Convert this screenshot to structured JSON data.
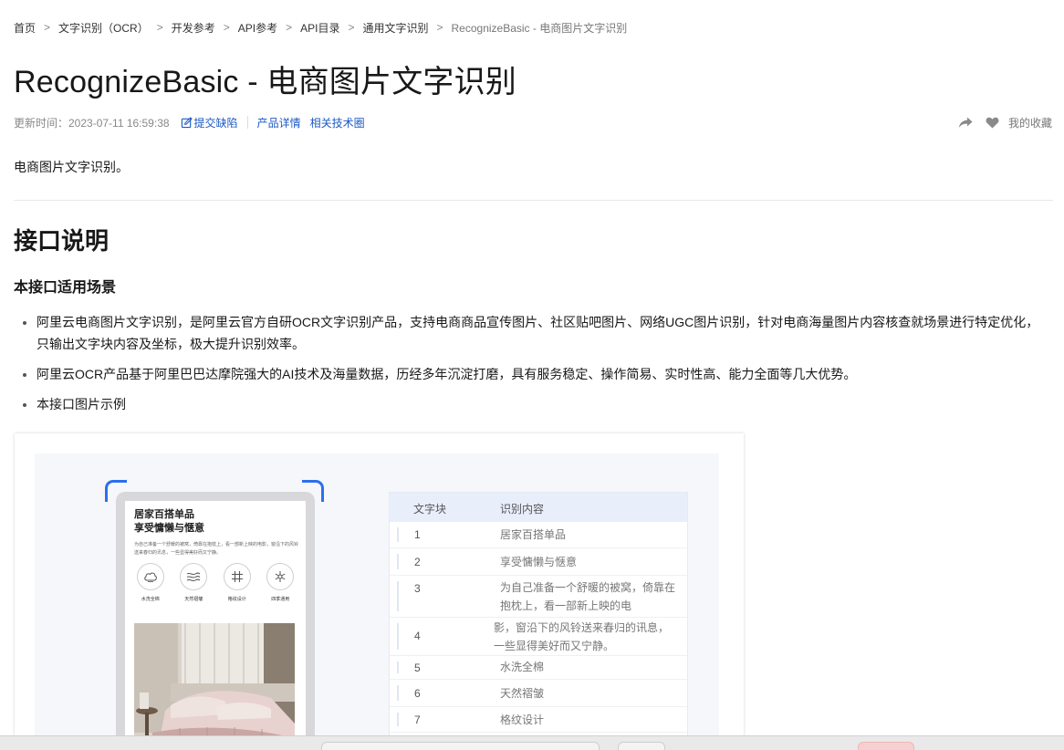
{
  "breadcrumb": {
    "items": [
      "首页",
      "文字识别（OCR）",
      "开发参考",
      "API参考",
      "API目录",
      "通用文字识别",
      "RecognizeBasic - 电商图片文字识别"
    ],
    "separator": ">"
  },
  "page": {
    "title": "RecognizeBasic - 电商图片文字识别",
    "updated": "更新时间：2023-07-11 16:59:38",
    "links": {
      "report_bug": "提交缺陷",
      "product_detail": "产品详情",
      "community": "相关技术圈"
    },
    "favorites": "我的收藏",
    "summary": "电商图片文字识别。"
  },
  "section": {
    "h2": "接口说明",
    "h3": "本接口适用场景",
    "bullets": [
      "阿里云电商图片文字识别，是阿里云官方自研OCR文字识别产品，支持电商商品宣传图片、社区贴吧图片、网络UGC图片识别，针对电商海量图片内容核查就场景进行特定优化，只输出文字块内容及坐标，极大提升识别效率。",
      "阿里云OCR产品基于阿里巴巴达摩院强大的AI技术及海量数据，历经多年沉淀打磨，具有服务稳定、操作简易、实时性高、能力全面等几大优势。",
      "本接口图片示例"
    ]
  },
  "example": {
    "phone": {
      "title_line1": "居家百搭单品",
      "title_line2": "享受慵懒与惬意",
      "desc": "为自己准备一个舒暖的被窝，倚靠在抱枕上，看一部新上映的电影，窗沿下的风铃送来春归的讯息，一些显得美好而又宁静。",
      "features": [
        "水洗全棉",
        "天然褶皱",
        "格纹设计",
        "四季通用"
      ]
    },
    "table": {
      "headers": [
        "文字块",
        "识别内容"
      ],
      "rows": [
        {
          "num": "1",
          "text": "居家百搭单品"
        },
        {
          "num": "2",
          "text": "享受慵懒与惬意"
        },
        {
          "num": "3",
          "text": "为自己准备一个舒暖的被窝，倚靠在抱枕上，看一部新上映的电"
        },
        {
          "num": "4",
          "text": "影，窗沿下的风铃送来春归的讯息，一些显得美好而又宁静。"
        },
        {
          "num": "5",
          "text": "水洗全棉"
        },
        {
          "num": "6",
          "text": "天然褶皱"
        },
        {
          "num": "7",
          "text": "格纹设计"
        }
      ]
    },
    "accent": "#2a6ff0"
  },
  "colors": {
    "link": "#1b58c4",
    "muted": "#888888",
    "text": "#181818"
  }
}
